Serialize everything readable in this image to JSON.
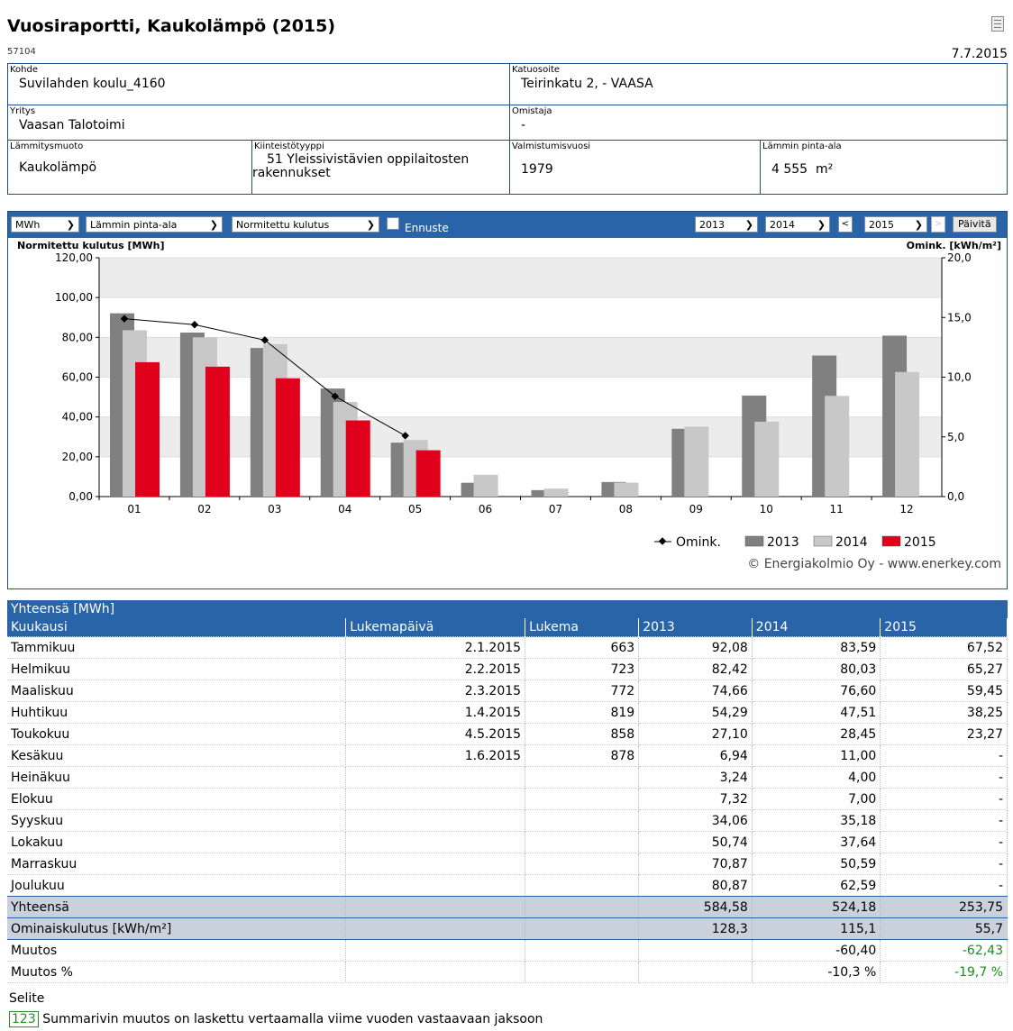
{
  "header": {
    "title": "Vuosiraportti, Kaukolämpö (2015)",
    "id": "57104",
    "date": "7.7.2015"
  },
  "info": {
    "kohde_label": "Kohde",
    "kohde": "Suvilahden koulu_4160",
    "katuosoite_label": "Katuosoite",
    "katuosoite": "Teirinkatu 2, - VAASA",
    "yritys_label": "Yritys",
    "yritys": "Vaasan Talotoimi",
    "omistaja_label": "Omistaja",
    "omistaja": "-",
    "lammitysmuoto_label": "Lämmitysmuoto",
    "lammitysmuoto": "Kaukolämpö",
    "kiinteistotyyppi_label": "Kiinteistötyyppi",
    "kiinteistotyyppi": "51 Yleissivistävien oppilaitosten rakennukset",
    "valmistumisvuosi_label": "Valmistumisvuosi",
    "valmistumisvuosi": "1979",
    "pinta_ala_label": "Lämmin pinta-ala",
    "pinta_ala": "4 555  m²"
  },
  "toolbar": {
    "unit": "MWh",
    "area": "Lämmin pinta-ala",
    "mode": "Normitettu kulutus",
    "forecast_label": "Ennuste",
    "forecast_checked": false,
    "year1": "2013",
    "year2": "2014",
    "prev": "<",
    "year3": "2015",
    "next": ">",
    "refresh": "Päivitä"
  },
  "chart_data": {
    "type": "bar",
    "ylabel_left": "Normitettu kulutus [MWh]",
    "ylabel_right": "Omink. [kWh/m²]",
    "categories": [
      "01",
      "02",
      "03",
      "04",
      "05",
      "06",
      "07",
      "08",
      "09",
      "10",
      "11",
      "12"
    ],
    "ylim": [
      0,
      120
    ],
    "yticks": [
      "0,00",
      "20,00",
      "40,00",
      "60,00",
      "80,00",
      "100,00",
      "120,00"
    ],
    "ylim_right": [
      0,
      20
    ],
    "yticks_right": [
      "0,0",
      "5,0",
      "10,0",
      "15,0",
      "20,0"
    ],
    "series": [
      {
        "name": "2013",
        "color": "#808080",
        "values": [
          92.08,
          82.42,
          74.66,
          54.29,
          27.1,
          6.94,
          3.24,
          7.32,
          34.06,
          50.74,
          70.87,
          80.87
        ]
      },
      {
        "name": "2014",
        "color": "#c8c8c8",
        "values": [
          83.59,
          80.03,
          76.6,
          47.51,
          28.45,
          11.0,
          4.0,
          7.0,
          35.18,
          37.64,
          50.59,
          62.59
        ]
      },
      {
        "name": "2015",
        "color": "#e0001b",
        "values": [
          67.52,
          65.27,
          59.45,
          38.25,
          23.27,
          null,
          null,
          null,
          null,
          null,
          null,
          null
        ]
      }
    ],
    "line": {
      "name": "Omink.",
      "values": [
        14.9,
        14.4,
        13.1,
        8.4,
        5.1
      ]
    },
    "copyright": "© Energiakolmio Oy - www.enerkey.com"
  },
  "table": {
    "caption": "Yhteensä [MWh]",
    "headers": [
      "Kuukausi",
      "Lukemapäivä",
      "Lukema",
      "2013",
      "2014",
      "2015"
    ],
    "rows": [
      [
        "Tammikuu",
        "2.1.2015",
        "663",
        "92,08",
        "83,59",
        "67,52"
      ],
      [
        "Helmikuu",
        "2.2.2015",
        "723",
        "82,42",
        "80,03",
        "65,27"
      ],
      [
        "Maaliskuu",
        "2.3.2015",
        "772",
        "74,66",
        "76,60",
        "59,45"
      ],
      [
        "Huhtikuu",
        "1.4.2015",
        "819",
        "54,29",
        "47,51",
        "38,25"
      ],
      [
        "Toukokuu",
        "4.5.2015",
        "858",
        "27,10",
        "28,45",
        "23,27"
      ],
      [
        "Kesäkuu",
        "1.6.2015",
        "878",
        "6,94",
        "11,00",
        "-"
      ],
      [
        "Heinäkuu",
        "",
        "",
        "3,24",
        "4,00",
        "-"
      ],
      [
        "Elokuu",
        "",
        "",
        "7,32",
        "7,00",
        "-"
      ],
      [
        "Syyskuu",
        "",
        "",
        "34,06",
        "35,18",
        "-"
      ],
      [
        "Lokakuu",
        "",
        "",
        "50,74",
        "37,64",
        "-"
      ],
      [
        "Marraskuu",
        "",
        "",
        "70,87",
        "50,59",
        "-"
      ],
      [
        "Joulukuu",
        "",
        "",
        "80,87",
        "62,59",
        "-"
      ]
    ],
    "summary": [
      [
        "Yhteensä",
        "",
        "",
        "584,58",
        "524,18",
        "253,75"
      ],
      [
        "Ominaiskulutus [kWh/m²]",
        "",
        "",
        "128,3",
        "115,1",
        "55,7"
      ]
    ],
    "changes": [
      [
        "Muutos",
        "",
        "",
        "",
        "-60,40",
        "-62,43"
      ],
      [
        "Muutos %",
        "",
        "",
        "",
        "-10,3 %",
        "-19,7 %"
      ]
    ]
  },
  "footer": {
    "selite": "Selite",
    "code": "123",
    "note": "Summarivin muutos on laskettu vertaamalla viime vuoden vastaavaan jaksoon"
  }
}
